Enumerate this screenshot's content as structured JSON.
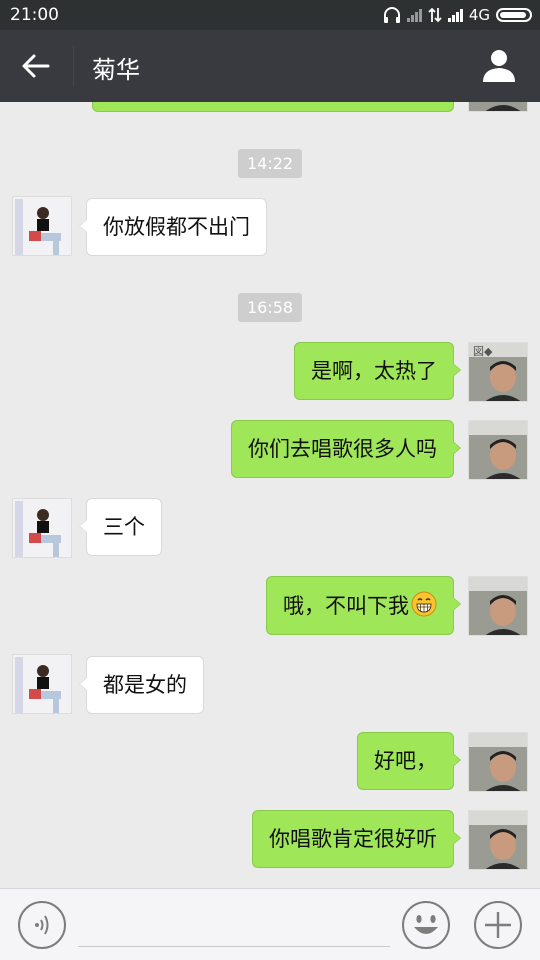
{
  "status_bar": {
    "time": "21:00",
    "network": "4G"
  },
  "header": {
    "title": "菊华"
  },
  "timestamps": [
    "14:22",
    "16:58"
  ],
  "messages": [
    {
      "side": "in",
      "text": "你放假都不出门"
    },
    {
      "side": "out",
      "text": "是啊，太热了"
    },
    {
      "side": "out",
      "text": "你们去唱歌很多人吗"
    },
    {
      "side": "in",
      "text": "三个"
    },
    {
      "side": "out",
      "text": "哦，不叫下我"
    },
    {
      "side": "in",
      "text": "都是女的"
    },
    {
      "side": "out",
      "text": "好吧，"
    },
    {
      "side": "out",
      "text": "你唱歌肯定很好听"
    }
  ],
  "colors": {
    "outgoing_bubble": "#9fe658",
    "incoming_bubble": "#ffffff",
    "title_bar": "#393a3f",
    "chat_background": "#ebebeb"
  },
  "icons": {
    "back": "back-arrow-icon",
    "profile": "person-icon",
    "voice": "voice-icon",
    "emoji": "emoji-icon",
    "more": "plus-icon",
    "grin": "grin-emoji-icon"
  },
  "input": {
    "value": "",
    "placeholder": ""
  }
}
